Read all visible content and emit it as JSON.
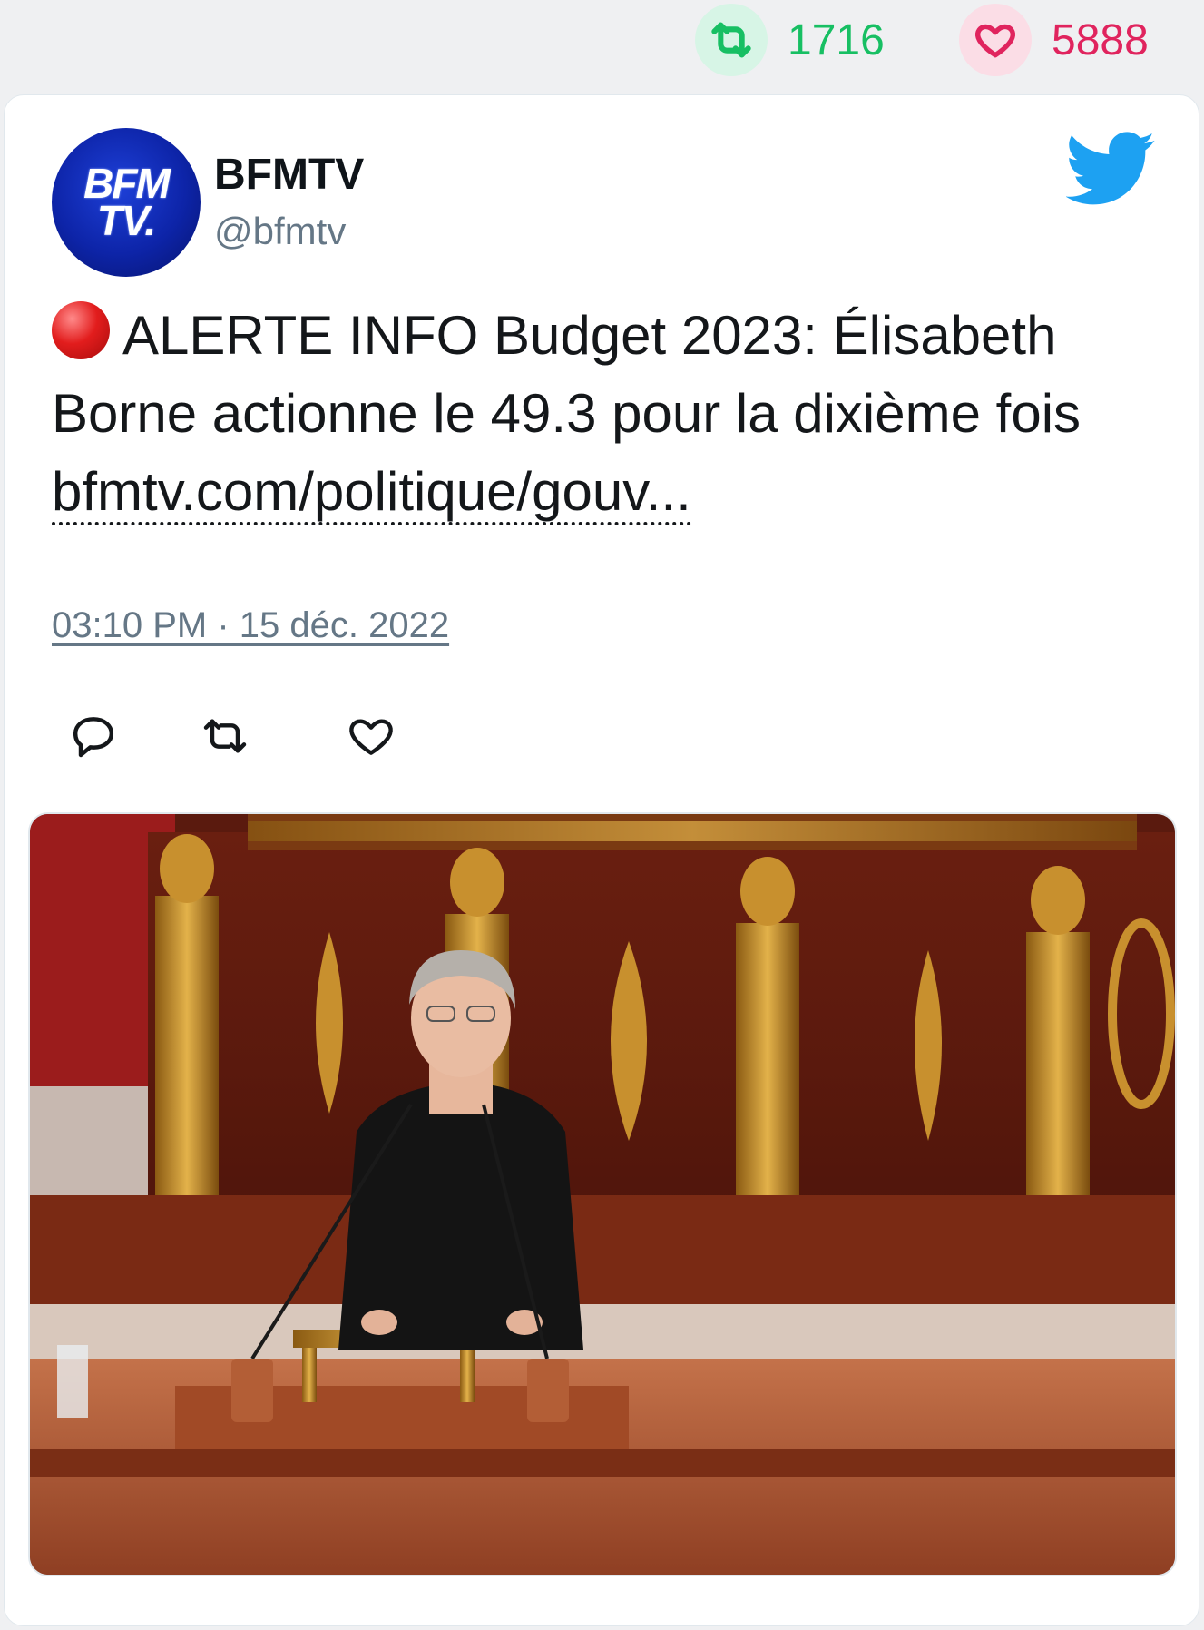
{
  "stats": {
    "retweets": "1716",
    "likes": "5888",
    "retweet_icon": "retweet-icon",
    "like_icon": "heart-icon"
  },
  "tweet": {
    "avatar_text_line1": "BFM",
    "avatar_text_line2": "TV.",
    "display_name": "BFMTV",
    "handle": "@bfmtv",
    "text_prefix": "ALERTE INFO Budget 2023: Élisabeth Borne actionne le 49.3 pour la dixième fois ",
    "link": "bfmtv.com/politique/gouv...",
    "timestamp": "03:10 PM · 15 déc. 2022"
  },
  "colors": {
    "retweet": "#17bf63",
    "like": "#e0245e",
    "twitter_blue": "#1da1f2",
    "muted": "#657786"
  }
}
